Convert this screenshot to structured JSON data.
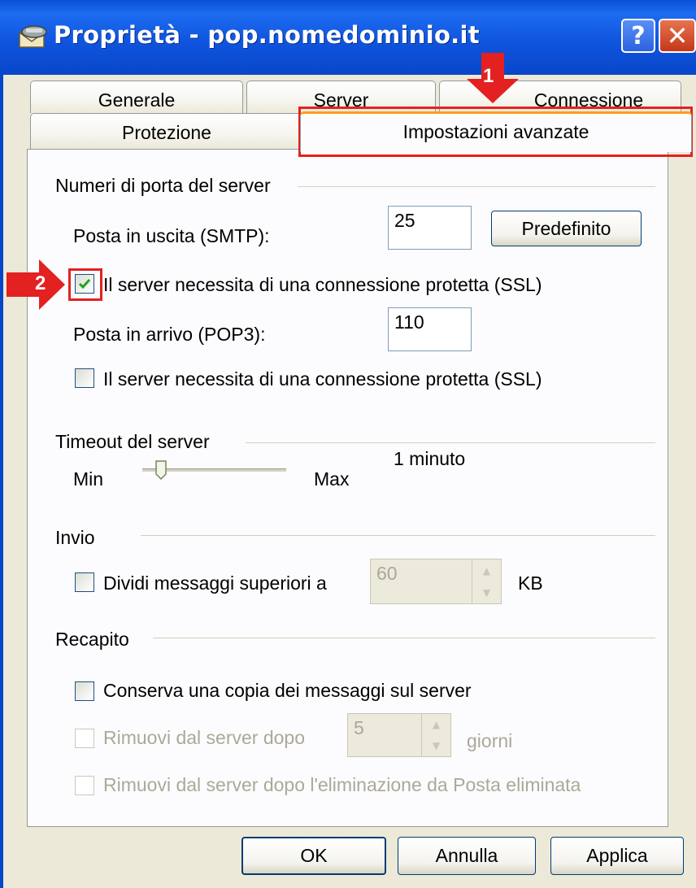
{
  "window": {
    "title": "Proprietà - pop.nomedominio.it",
    "help_label": "?",
    "close_label": "✕"
  },
  "tabs": {
    "row1": [
      "Generale",
      "Server",
      "Connessione"
    ],
    "row2": [
      "Protezione",
      "Impostazioni avanzate"
    ],
    "active": "Impostazioni avanzate"
  },
  "ports": {
    "heading": "Numeri di porta del server",
    "smtp_label": "Posta in uscita (SMTP):",
    "smtp_value": "25",
    "default_button": "Predefinito",
    "smtp_ssl_label": "Il server necessita di una connessione protetta (SSL)",
    "smtp_ssl_checked": true,
    "pop3_label": "Posta in arrivo (POP3):",
    "pop3_value": "110",
    "pop3_ssl_label": "Il server necessita di una connessione protetta (SSL)",
    "pop3_ssl_checked": false
  },
  "timeout": {
    "heading": "Timeout del server",
    "min_label": "Min",
    "max_label": "Max",
    "value_text": "1 minuto",
    "slider_level": 0.1
  },
  "send": {
    "heading": "Invio",
    "split_label": "Dividi messaggi superiori a",
    "split_checked": false,
    "split_value": "60",
    "unit": "KB"
  },
  "delivery": {
    "heading": "Recapito",
    "keep_copy_label": "Conserva una copia dei messaggi sul server",
    "keep_copy_checked": false,
    "remove_after_label": "Rimuovi dal server dopo",
    "remove_after_value": "5",
    "remove_after_unit": "giorni",
    "remove_deleted_label": "Rimuovi dal server dopo l'eliminazione da Posta eliminata"
  },
  "footer": {
    "ok": "OK",
    "cancel": "Annulla",
    "apply": "Applica"
  },
  "annotations": {
    "marker1": "1",
    "marker2": "2",
    "highlight_color": "#e32121"
  }
}
